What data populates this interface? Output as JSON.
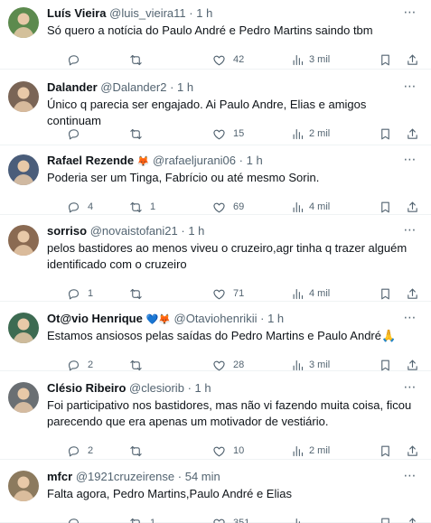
{
  "tweets": [
    {
      "name": "Luís Vieira",
      "name_emoji": "",
      "handle": "@luis_vieira11",
      "time": "1 h",
      "text": "Só quero a notícia do Paulo André e Pedro Martins saindo tbm",
      "replies": "",
      "retweets": "",
      "likes": "42",
      "views": "3 mil",
      "avatar_color": "#5c8a4e"
    },
    {
      "name": "Dalander",
      "name_emoji": "",
      "handle": "@Dalander2",
      "time": "1 h",
      "text": "Único q parecia ser engajado. Ai Paulo Andre, Elias e amigos continuam",
      "replies": "",
      "retweets": "",
      "likes": "15",
      "views": "2 mil",
      "avatar_color": "#7a6556"
    },
    {
      "name": "Rafael Rezende",
      "name_emoji": "🦊",
      "handle": "@rafaeljurani06",
      "time": "1 h",
      "text": "Poderia ser um Tinga, Fabrício ou até mesmo Sorin.",
      "replies": "4",
      "retweets": "1",
      "likes": "69",
      "views": "4 mil",
      "avatar_color": "#4a5d7a"
    },
    {
      "name": "sorriso",
      "name_emoji": "",
      "handle": "@novaistofani21",
      "time": "1 h",
      "text": "pelos bastidores ao menos viveu o cruzeiro,agr tinha q trazer alguém identificado com o cruzeiro",
      "replies": "1",
      "retweets": "",
      "likes": "71",
      "views": "4 mil",
      "avatar_color": "#8a6a52"
    },
    {
      "name": "Ot@vio Henrique",
      "name_emoji": "💙🦊",
      "handle": "@Otaviohenrikii",
      "time": "1 h",
      "text": "Estamos ansiosos pelas saídas do Pedro Martins e Paulo André🙏",
      "replies": "2",
      "retweets": "",
      "likes": "28",
      "views": "3 mil",
      "avatar_color": "#3d6b52"
    },
    {
      "name": "Clésio Ribeiro",
      "name_emoji": "",
      "handle": "@clesiorib",
      "time": "1 h",
      "text": "Foi participativo nos bastidores, mas não vi fazendo muita coisa, ficou parecendo que era apenas um motivador de vestiário.",
      "replies": "2",
      "retweets": "",
      "likes": "10",
      "views": "2 mil",
      "avatar_color": "#6a6f73"
    },
    {
      "name": "mfcr",
      "name_emoji": "",
      "handle": "@1921cruzeirense",
      "time": "54 min",
      "text": "Falta agora, Pedro Martins,Paulo André e Elias",
      "replies": "",
      "retweets": "1",
      "likes": "351",
      "views": "",
      "avatar_color": "#8c7a5e"
    }
  ],
  "separator": "·",
  "more_icon": "⋯",
  "icons": [
    "reply-icon",
    "retweet-icon",
    "like-icon",
    "views-icon",
    "bookmark-icon",
    "share-icon"
  ],
  "colors": {
    "text": "#0f1419",
    "secondary": "#536471",
    "divider": "#eff3f4",
    "background": "#ffffff"
  }
}
